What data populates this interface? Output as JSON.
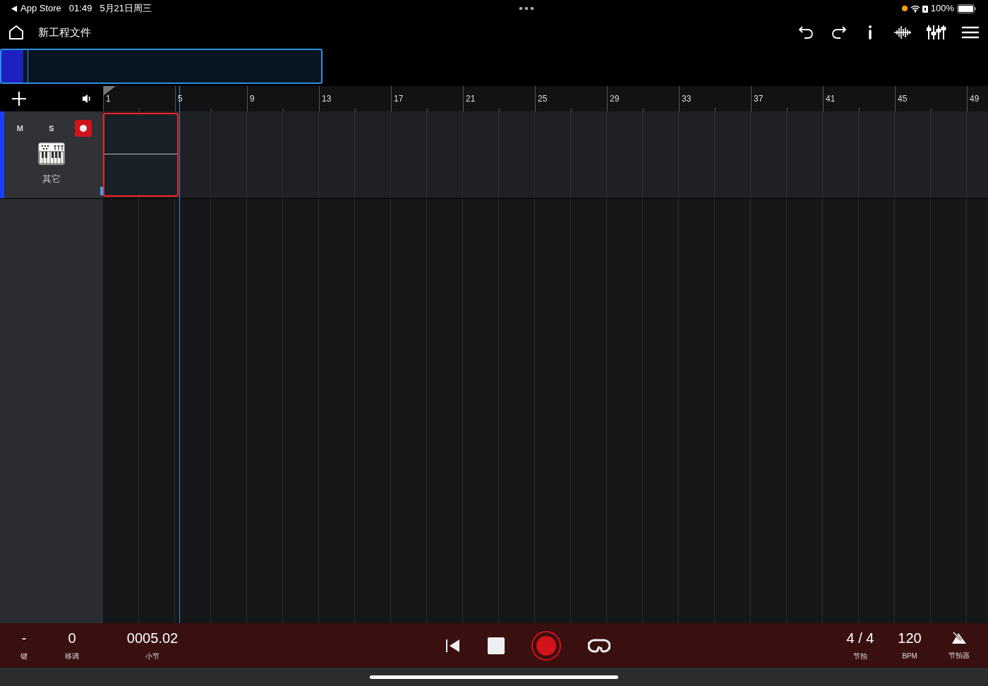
{
  "status_bar": {
    "back_app": "App Store",
    "time": "01:49",
    "date": "5月21日周三",
    "battery": "100%"
  },
  "header": {
    "title": "新工程文件"
  },
  "ruler": {
    "labels": [
      "1",
      "5",
      "9",
      "13",
      "17",
      "21",
      "25",
      "29",
      "33",
      "37",
      "41",
      "45",
      "49"
    ]
  },
  "tracks": [
    {
      "mute": "M",
      "solo": "S",
      "armed": true,
      "name": "其它",
      "clip": {
        "selected": true
      }
    }
  ],
  "transport": {
    "left": [
      {
        "value": "-",
        "label": "键"
      },
      {
        "value": "0",
        "label": "移调"
      },
      {
        "value": "0005.02",
        "label": "小节"
      }
    ],
    "recording": true,
    "right": [
      {
        "kind": "text",
        "value": "4 / 4",
        "label": "节拍"
      },
      {
        "kind": "text",
        "value": "120",
        "label": "BPM"
      },
      {
        "kind": "icon",
        "label": "节拍器"
      }
    ]
  }
}
